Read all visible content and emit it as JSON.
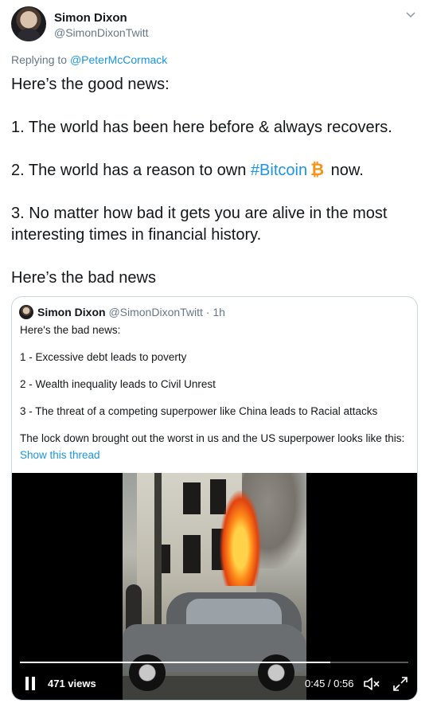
{
  "author": {
    "display_name": "Simon Dixon",
    "handle": "@SimonDixonTwitt"
  },
  "reply": {
    "prefix": "Replying to ",
    "to": "@PeterMcCormack"
  },
  "tweet": {
    "line1": "Here’s the good news:",
    "line2": "1. The world has been here before &  always recovers.",
    "line3_before": "2. The world has a reason to own ",
    "line3_hashtag": "#Bitcoin",
    "line3_after": " now.",
    "line4": "3. No matter how bad it gets you are alive in the most interesting times in financial history.",
    "line5": "Here’s the bad news"
  },
  "quote": {
    "display_name": "Simon Dixon",
    "handle": "@SimonDixonTwitt",
    "time": " · 1h",
    "p1": "Here's the bad news:",
    "p2": "1 - Excessive debt leads to poverty",
    "p3": "2 - Wealth inequality leads to Civil Unrest",
    "p4": "3 - The threat of a competing superpower like China leads to Racial attacks",
    "p5": "The lock down brought out the worst in us and the US superpower looks like this:",
    "show_thread": "Show this thread"
  },
  "video": {
    "views": "471 views",
    "time": "0:45 / 0:56",
    "progress": 0.8
  },
  "colors": {
    "link": "#1b95e0",
    "bitcoin": "#f7931a",
    "secondary_text": "#657786"
  },
  "icons": [
    "avatar",
    "chevron-down-icon",
    "bitcoin-icon",
    "pause-icon",
    "volume-muted-icon",
    "expand-icon"
  ]
}
